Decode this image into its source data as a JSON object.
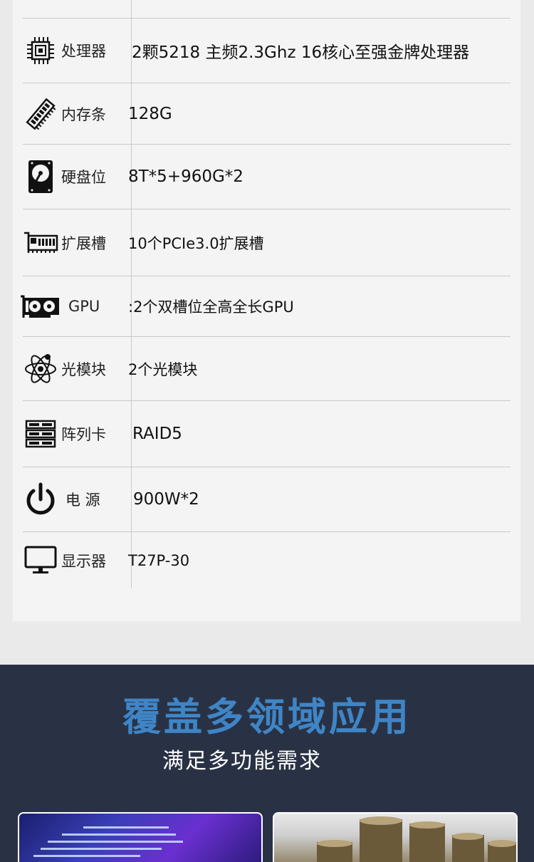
{
  "specs": [
    {
      "id": "cpu",
      "label": "处理器",
      "icon": "cpu-chip-icon",
      "value": "2颗5218 主频2.3Ghz 16核心至强金牌处理器"
    },
    {
      "id": "memory",
      "label": "内存条",
      "icon": "memory-stick-icon",
      "value": "128G"
    },
    {
      "id": "disk",
      "label": "硬盘位",
      "icon": "hard-disk-icon",
      "value": "8T*5+960G*2"
    },
    {
      "id": "expansion",
      "label": "扩展槽",
      "icon": "expansion-card-icon",
      "value": "10个PCIe3.0扩展槽"
    },
    {
      "id": "gpu",
      "label": "GPU",
      "icon": "graphics-card-icon",
      "value": ":2个双槽位全高全长GPU"
    },
    {
      "id": "optical",
      "label": "光模块",
      "icon": "atom-icon",
      "value": "2个光模块"
    },
    {
      "id": "raid",
      "label": "阵列卡",
      "icon": "server-rack-icon",
      "value": "RAID5"
    },
    {
      "id": "power",
      "label": "电 源",
      "icon": "power-icon",
      "value": "900W*2"
    },
    {
      "id": "display",
      "label": "显示器",
      "icon": "monitor-icon",
      "value": "T27P-30"
    }
  ],
  "applications": {
    "title": "覆盖多领域应用",
    "subtitle": "满足多功能需求"
  },
  "colors": {
    "section_bg": "#293245",
    "title_blue": "#3f85c6",
    "card_bg": "#f4f4f4"
  }
}
